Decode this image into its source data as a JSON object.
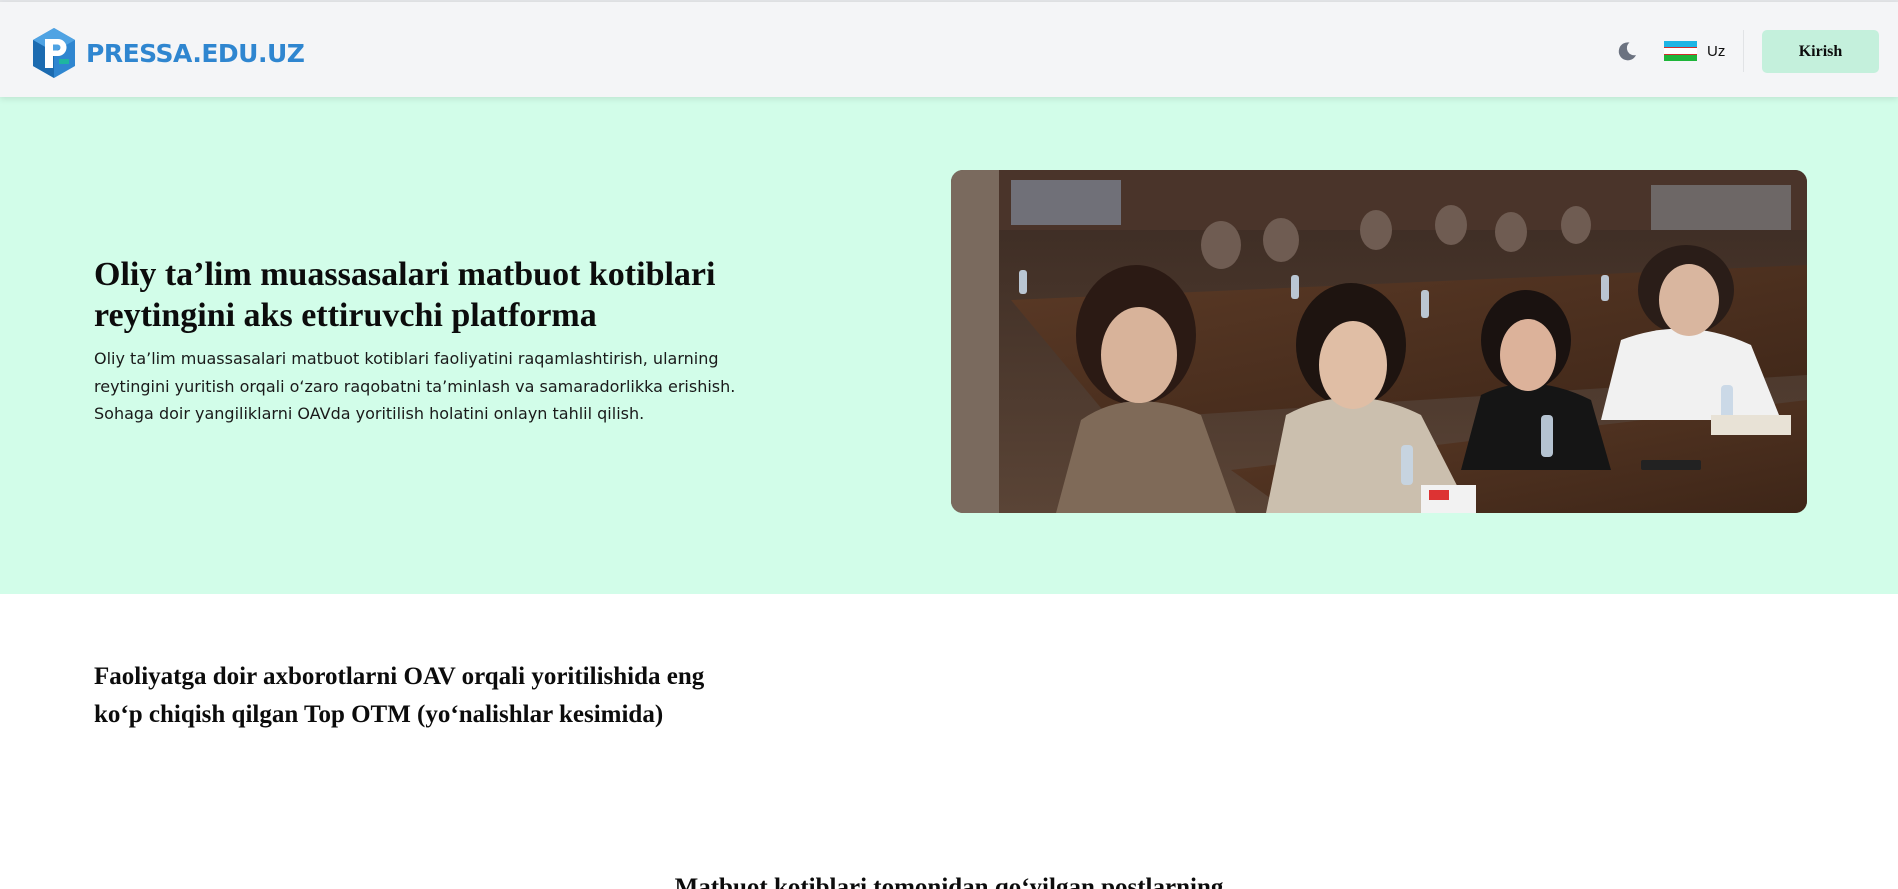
{
  "header": {
    "logo_text": "PRESSA.EDU.UZ",
    "theme_icon": "moon-icon",
    "language": {
      "label": "Uz",
      "flag_icon": "uzbekistan-flag-icon"
    },
    "login_label": "Kirish"
  },
  "hero": {
    "title": "Oliy ta’lim muassasalari matbuot kotiblari reytingini aks ettiruvchi platforma",
    "description": "Oliy ta’lim muassasalari matbuot kotiblari faoliyatini raqamlashtirish, ularning reytingini yuritish orqali o‘zaro raqobatni ta’minlash va samaradorlikka erishish. Sohaga doir yangiliklarni OAVda yoritilish holatini onlayn tahlil qilish.",
    "image_icon": "seminar-photo-image"
  },
  "sections": {
    "top_otm_title": "Faoliyatga doir axborotlarni OAV orqali yoritilishida eng ko‘p chiqish qilgan Top OTM (yo‘nalishlar kesimida)",
    "posts_title": "Matbuot kotiblari tomonidan qo‘yilgan postlarning"
  },
  "colors": {
    "brand_blue": "#2f86d0",
    "hero_background": "#d2fde9",
    "login_button": "#c4f0dc",
    "navbar_background": "#f4f5f7"
  }
}
